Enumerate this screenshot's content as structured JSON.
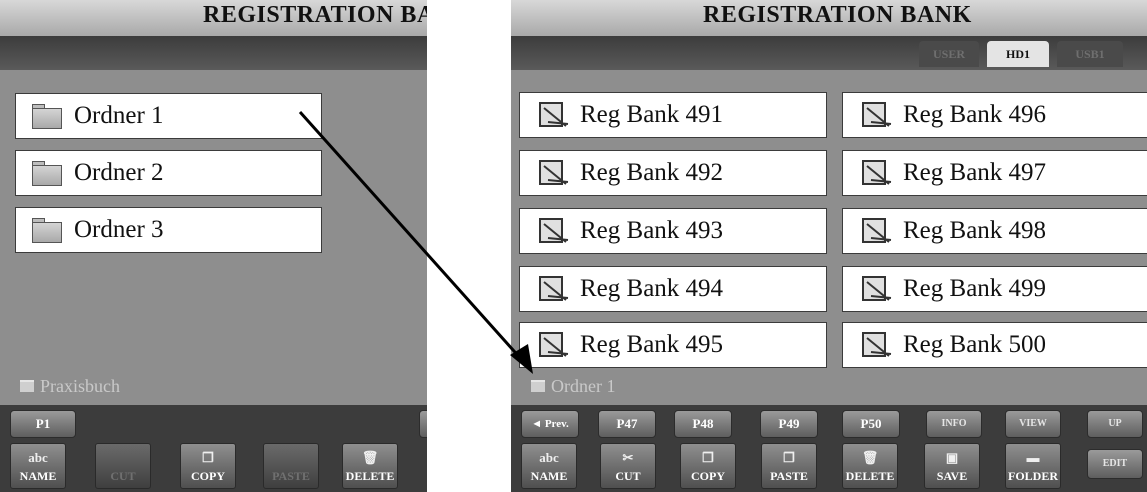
{
  "left": {
    "title": "REGISTRATION BA",
    "folders": [
      "Ordner 1",
      "Ordner 2",
      "Ordner 3"
    ],
    "path": "Praxisbuch",
    "page_button": "P1",
    "func": {
      "name_top": "abc",
      "name": "NAME",
      "cut": "CUT",
      "copy": "COPY",
      "paste": "PASTE",
      "delete": "DELETE"
    }
  },
  "right": {
    "title": "REGISTRATION BANK",
    "tabs": [
      "USER",
      "HD1",
      "USB1"
    ],
    "banks_col1": [
      "Reg Bank 491",
      "Reg Bank 492",
      "Reg Bank 493",
      "Reg Bank 494",
      "Reg Bank 495"
    ],
    "banks_col2": [
      "Reg Bank 496",
      "Reg Bank 497",
      "Reg Bank 498",
      "Reg Bank 499",
      "Reg Bank 500"
    ],
    "path": "Ordner 1",
    "nav": {
      "prev": "◄ Prev.",
      "p47": "P47",
      "p48": "P48",
      "p49": "P49",
      "p50": "P50",
      "info": "INFO",
      "view": "VIEW",
      "up": "UP"
    },
    "func": {
      "name_top": "abc",
      "name": "NAME",
      "cut": "CUT",
      "copy": "COPY",
      "paste": "PASTE",
      "delete": "DELETE",
      "save": "SAVE",
      "folder": "FOLDER",
      "edit": "EDIT"
    }
  },
  "colors": {
    "screen_bg": "#8e8e8e",
    "button_bar": "#3c3c3c",
    "file_bg": "#ffffff",
    "arrow": "#000000"
  }
}
